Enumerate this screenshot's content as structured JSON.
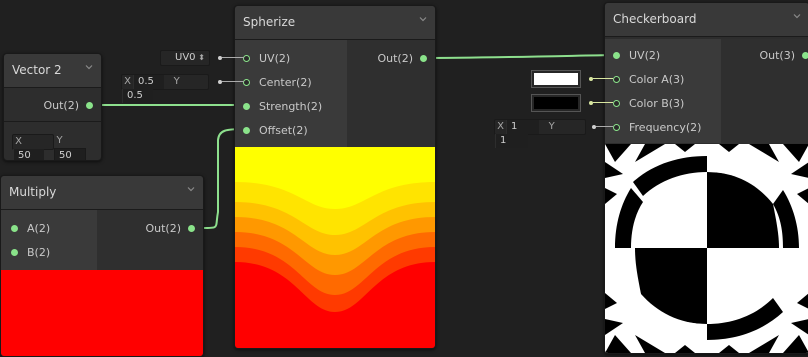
{
  "nodes": {
    "vector2": {
      "title": "Vector 2",
      "out_label": "Out(2)",
      "x_axis": "X",
      "x_value": "50",
      "y_axis": "Y",
      "y_value": "50"
    },
    "multiply": {
      "title": "Multiply",
      "inputs": [
        "A(2)",
        "B(2)"
      ],
      "out_label": "Out(2)",
      "preview_color": "#ff0000"
    },
    "spherize": {
      "title": "Spherize",
      "inputs": [
        "UV(2)",
        "Center(2)",
        "Strength(2)",
        "Offset(2)"
      ],
      "out_label": "Out(2)",
      "uv_dropdown": "UV0",
      "center_x_axis": "X",
      "center_x": "0.5",
      "center_y_axis": "Y",
      "center_y": "0.5"
    },
    "checkerboard": {
      "title": "Checkerboard",
      "inputs": [
        "UV(2)",
        "Color A(3)",
        "Color B(3)",
        "Frequency(2)"
      ],
      "out_label": "Out(3)",
      "color_a": "#ffffff",
      "color_b": "#000000",
      "freq_x_axis": "X",
      "freq_x": "1",
      "freq_y_axis": "Y",
      "freq_y": "1"
    }
  },
  "colors": {
    "wire": "#8ee08e",
    "node_bg": "#2d2d2d",
    "header_bg": "#393939",
    "canvas_bg": "#202020"
  },
  "icons": {
    "collapse": "chevron-down-icon",
    "dropdown": "dropdown-arrows-icon"
  }
}
